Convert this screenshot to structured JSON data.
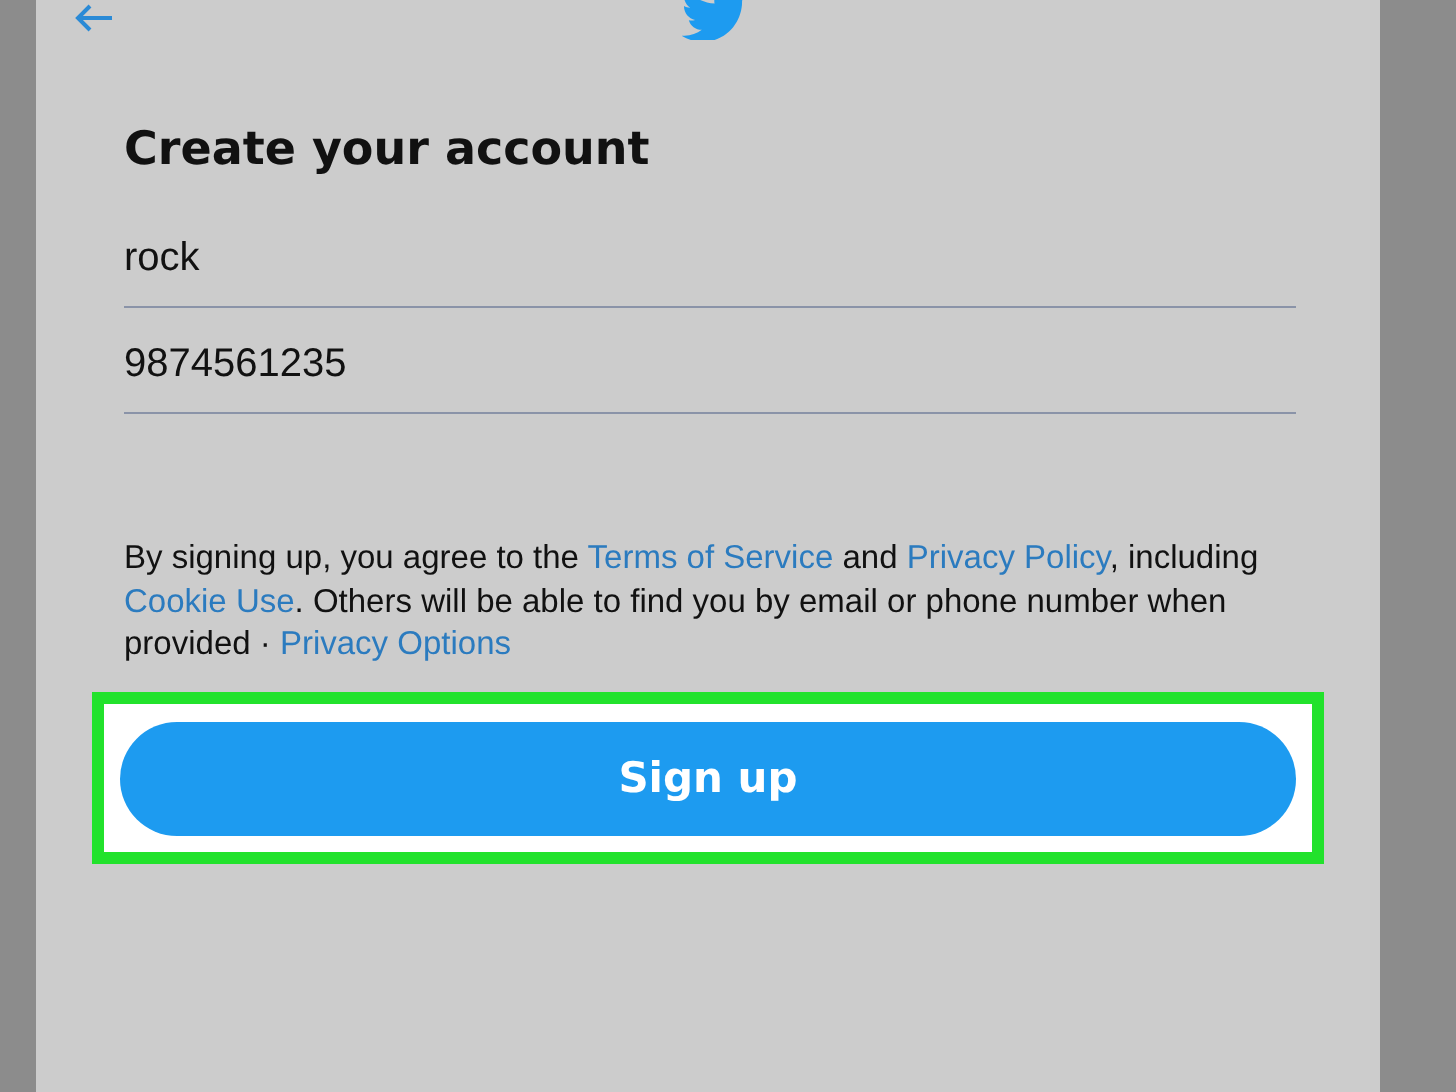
{
  "heading": "Create your account",
  "fields": [
    {
      "value": "rock"
    },
    {
      "value": "9874561235"
    }
  ],
  "consent": [
    {
      "kind": "text",
      "text": "By signing up, you agree to the "
    },
    {
      "kind": "link",
      "text": "Terms of Service"
    },
    {
      "kind": "text",
      "text": " and "
    },
    {
      "kind": "link",
      "text": "Privacy Policy"
    },
    {
      "kind": "text",
      "text": ", including "
    },
    {
      "kind": "link",
      "text": "Cookie Use"
    },
    {
      "kind": "text",
      "text": ". Others will be able to find you by email or phone number when provided · "
    },
    {
      "kind": "link",
      "text": "Privacy Options"
    }
  ],
  "signup_button": {
    "label": "Sign up",
    "highlighted": true
  }
}
